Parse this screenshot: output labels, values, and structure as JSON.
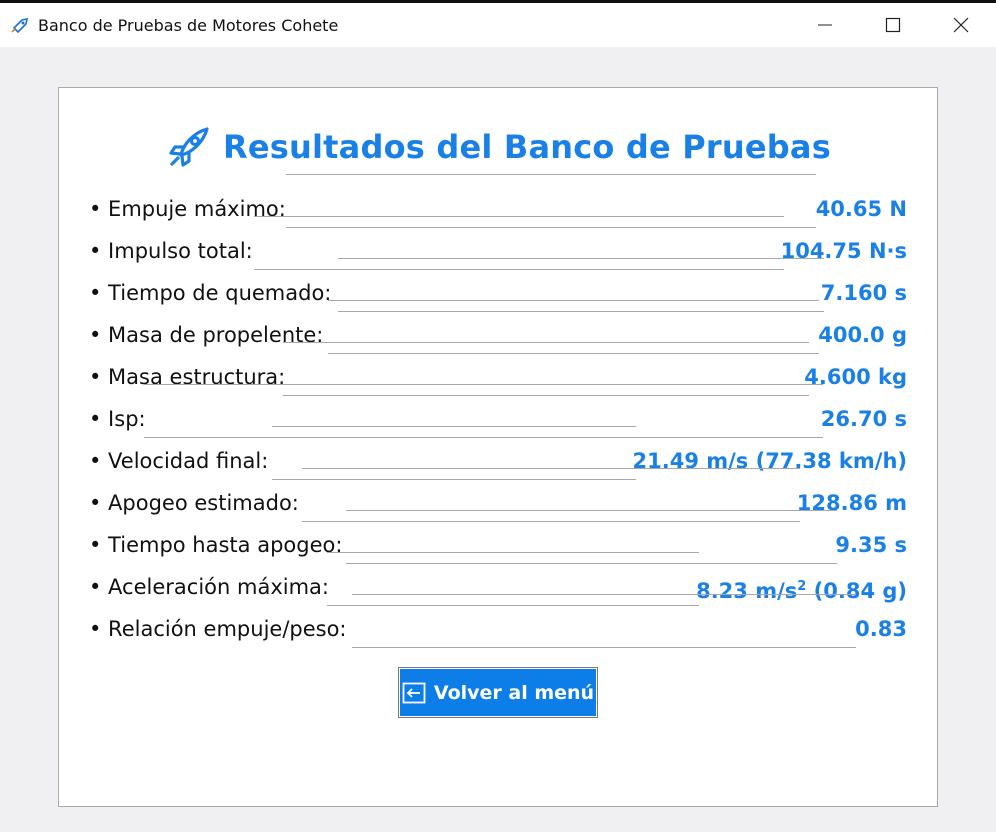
{
  "window": {
    "title": "Banco de Pruebas de Motores Cohete",
    "icon": "rocket-app-icon"
  },
  "colors": {
    "accent": "#1a80e6",
    "button_bg": "#0d7de8",
    "panel_bg": "#ffffff",
    "window_bg": "#f0f0f3"
  },
  "results": {
    "heading": "Resultados del Banco de Pruebas",
    "heading_icon": "rocket-icon",
    "rows": [
      {
        "label": "• Empuje máximo:",
        "value": "40.65 N"
      },
      {
        "label": "• Impulso total:",
        "value": "104.75 N·s"
      },
      {
        "label": "• Tiempo de quemado:",
        "value": "7.160 s"
      },
      {
        "label": "• Masa de propelente:",
        "value": "400.0 g"
      },
      {
        "label": "• Masa estructura:",
        "value": "4.600 kg"
      },
      {
        "label": "• Isp:",
        "value": "26.70 s"
      },
      {
        "label": "• Velocidad final:",
        "value": "21.49 m/s (77.38 km/h)"
      },
      {
        "label": "• Apogeo estimado:",
        "value": "128.86 m"
      },
      {
        "label": "• Tiempo hasta apogeo:",
        "value": "9.35 s"
      },
      {
        "label": "• Aceleración máxima:",
        "value_main": "8.23 m/s",
        "value_sup": "2",
        "value_tail": " (0.84 g)"
      },
      {
        "label": "• Relación empuje/peso:",
        "value": "0.83"
      }
    ]
  },
  "back_button": {
    "label": "Volver al menú",
    "icon": "back-arrow-icon"
  }
}
